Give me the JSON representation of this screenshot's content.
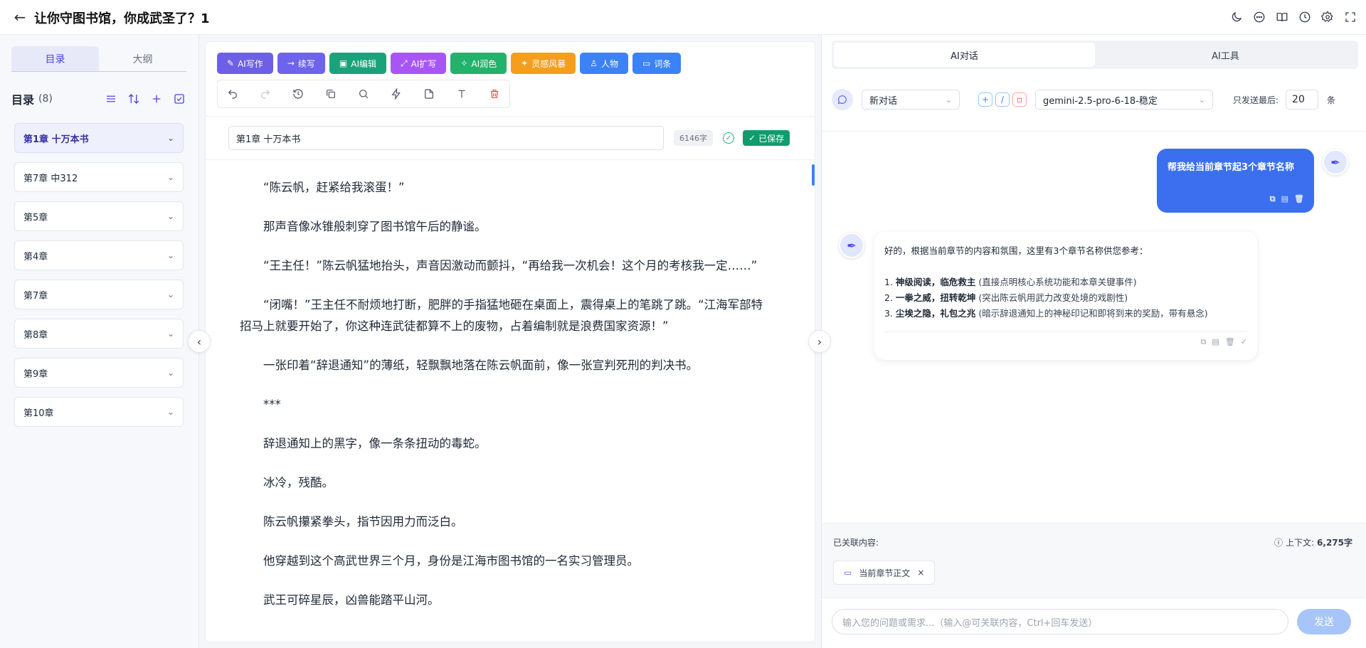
{
  "header": {
    "title": "让你守图书馆，你成武圣了？1",
    "icons": [
      "moon-icon",
      "chat-icon",
      "book-icon",
      "clock-icon",
      "gear-icon",
      "fullscreen-icon"
    ]
  },
  "sidebar": {
    "tabs": [
      {
        "label": "目录"
      },
      {
        "label": "大纲"
      }
    ],
    "toc_title": "目录",
    "toc_count": "(8)",
    "chapters": [
      {
        "label": "第1章 十万本书"
      },
      {
        "label": "第7章 中312"
      },
      {
        "label": "第5章"
      },
      {
        "label": "第4章"
      },
      {
        "label": "第7章"
      },
      {
        "label": "第8章"
      },
      {
        "label": "第9章"
      },
      {
        "label": "第10章"
      }
    ]
  },
  "toolbar": {
    "ai_buttons": [
      {
        "label": "AI写作",
        "color": "#6d5fe6",
        "icon": "pen-icon"
      },
      {
        "label": "续写",
        "color": "#6d63ec",
        "icon": "arrow-right-icon"
      },
      {
        "label": "AI编辑",
        "color": "#1aa37a",
        "icon": "edit-icon"
      },
      {
        "label": "AI扩写",
        "color": "#a855f7",
        "icon": "expand-icon"
      },
      {
        "label": "AI润色",
        "color": "#22b26b",
        "icon": "sparkle-icon"
      },
      {
        "label": "灵感风暴",
        "color": "#f59e1c",
        "icon": "lightbulb-icon"
      },
      {
        "label": "人物",
        "color": "#3b82f6",
        "icon": "user-icon"
      },
      {
        "label": "词条",
        "color": "#3b82f6",
        "icon": "book-open-icon"
      }
    ]
  },
  "editor": {
    "chapter_title": "第1章 十万本书",
    "word_count": "6146字",
    "saved_label": "已保存",
    "paragraphs": [
      "“陈云帆，赶紧给我滚蛋！”",
      "那声音像冰锥般刺穿了图书馆午后的静谧。",
      "“王主任！”陈云帆猛地抬头，声音因激动而颤抖，“再给我一次机会！这个月的考核我一定……”",
      "“闭嘴！”王主任不耐烦地打断，肥胖的手指猛地砸在桌面上，震得桌上的笔跳了跳。“江海军部特招马上就要开始了，你这种连武徒都算不上的废物，占着编制就是浪费国家资源！”",
      "一张印着“辞退通知”的薄纸，轻飘飘地落在陈云帆面前，像一张宣判死刑的判决书。",
      "***",
      "辞退通知上的黑字，像一条条扭动的毒蛇。",
      "冰冷，残酷。",
      "陈云帆攥紧拳头，指节因用力而泛白。",
      "他穿越到这个高武世界三个月，身份是江海市图书馆的一名实习管理员。",
      "武王可碎星辰，凶兽能踏平山河。"
    ]
  },
  "right_panel": {
    "tabs": [
      {
        "label": "AI对话"
      },
      {
        "label": "AI工具"
      }
    ],
    "conversation_select": "新对话",
    "model_select": "gemini-2.5-pro-6-18-稳定",
    "send_last_label": "只发送最后:",
    "send_last_value": "20",
    "unit_label": "条",
    "user_message": "帮我给当前章节起3个章节名称",
    "bot_message": {
      "intro": "好的，根据当前章节的内容和氛围，这里有3个章节名称供您参考：",
      "items": [
        {
          "num": "1.",
          "title": "神级阅读，临危救主",
          "note": "(直接点明核心系统功能和本章关键事件)"
        },
        {
          "num": "2.",
          "title": "一拳之威，扭转乾坤",
          "note": "(突出陈云帆用武力改变处境的戏剧性)"
        },
        {
          "num": "3.",
          "title": "尘埃之隐，礼包之兆",
          "note": "(暗示辞退通知上的神秘印记和即将到来的奖励，带有悬念)"
        }
      ]
    },
    "context_label": "已关联内容:",
    "context_size_label": "上下文:",
    "context_size_value": "6,275字",
    "context_chip": "当前章节正文",
    "input_placeholder": "输入您的问题或需求...（输入@可关联内容，Ctrl+回车发送）",
    "send_label": "发送"
  }
}
